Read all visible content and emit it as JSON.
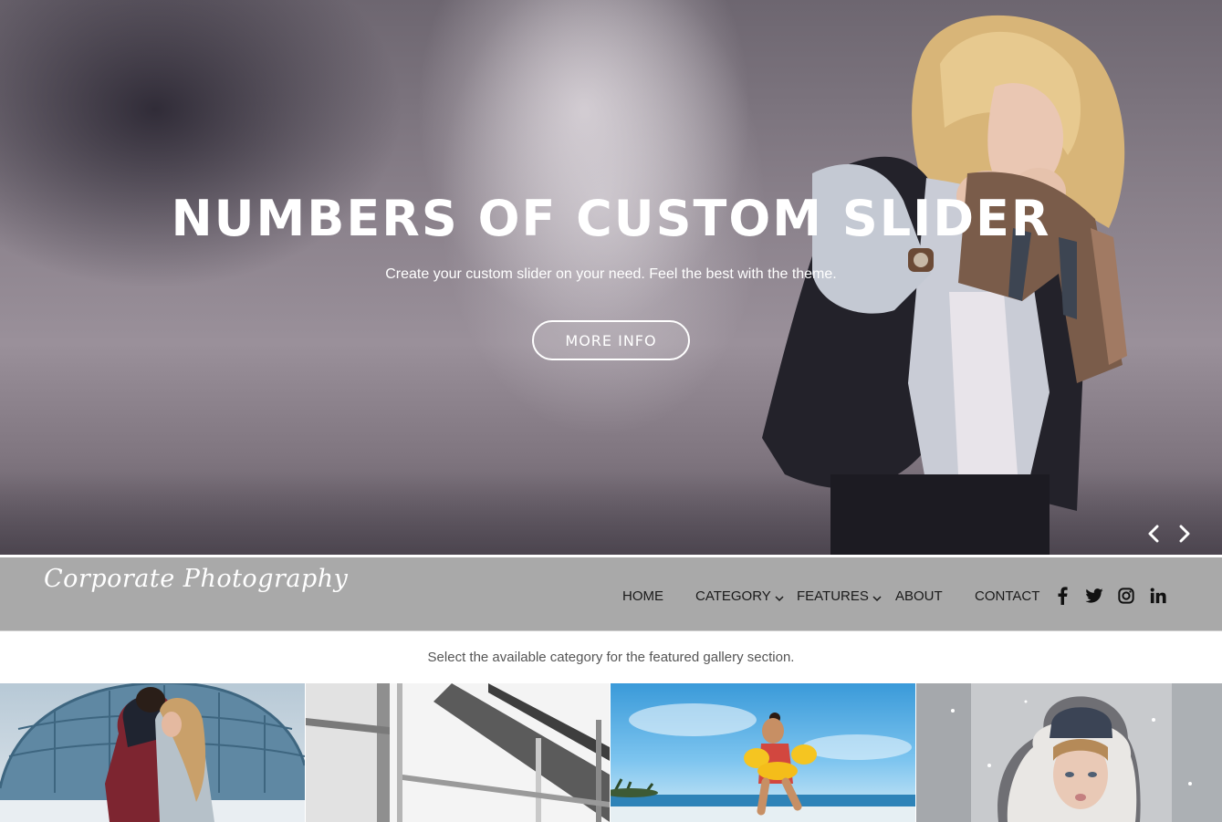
{
  "hero": {
    "title": "NUMBERS OF CUSTOM SLIDER",
    "subtitle": "Create your custom slider on your need. Feel the best with the theme.",
    "button_label": "MORE INFO"
  },
  "navbar": {
    "logo": "Corporate Photography",
    "items": [
      {
        "label": "HOME"
      },
      {
        "label": "CATEGORY",
        "has_dropdown": true
      },
      {
        "label": "FEATURES",
        "has_dropdown": true
      },
      {
        "label": "ABOUT"
      },
      {
        "label": "CONTACT"
      }
    ],
    "social": [
      "facebook-icon",
      "twitter-icon",
      "instagram-icon",
      "linkedin-icon"
    ]
  },
  "category_text": "Select the available category for the featured gallery section.",
  "gallery": {
    "tiles": [
      "couple-photo",
      "window-photo",
      "beach-child-photo",
      "winter-portrait-photo"
    ]
  },
  "colors": {
    "navbar_bg": "#a9a9a9",
    "nav_text": "#1a1a1a",
    "hero_text": "#ffffff",
    "body_text": "#555555"
  }
}
